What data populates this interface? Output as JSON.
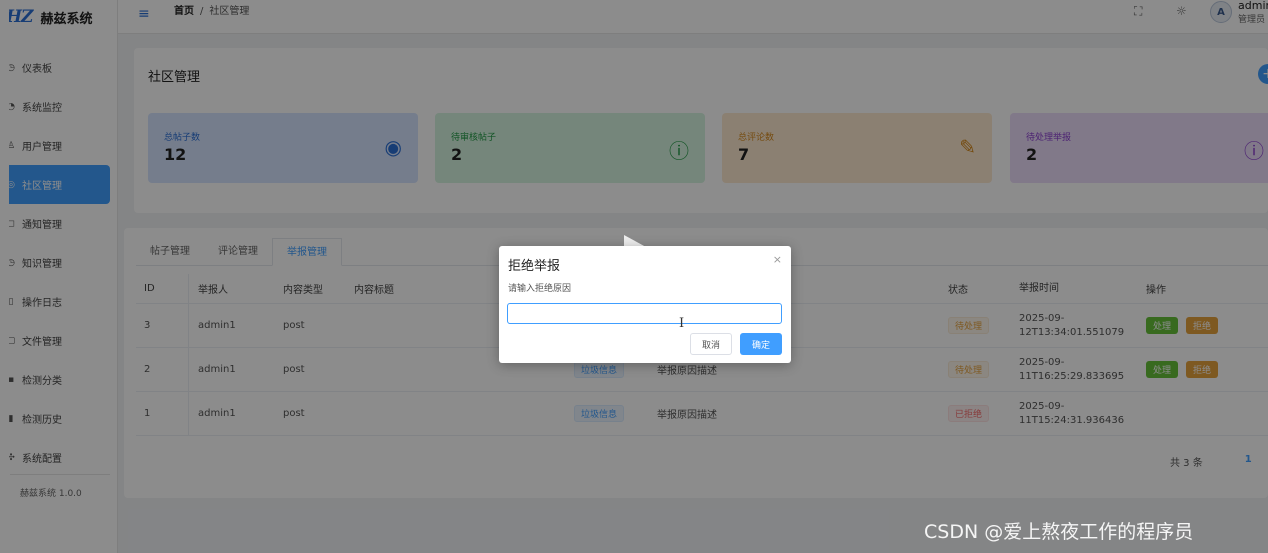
{
  "app": {
    "logo_mark": "HZ",
    "name": "赫兹系统",
    "version": "赫兹系统 1.0.0"
  },
  "sidebar": {
    "items": [
      {
        "label": "仪表板",
        "icon": "dashboard-icon",
        "glyph": "◷"
      },
      {
        "label": "系统监控",
        "icon": "monitor-icon",
        "glyph": "◔"
      },
      {
        "label": "用户管理",
        "icon": "user-icon",
        "glyph": "♙"
      },
      {
        "label": "社区管理",
        "icon": "community-icon",
        "glyph": "◎",
        "active": true
      },
      {
        "label": "通知管理",
        "icon": "bell-icon",
        "glyph": "◻"
      },
      {
        "label": "知识管理",
        "icon": "book-icon",
        "glyph": "◷"
      },
      {
        "label": "操作日志",
        "icon": "log-icon",
        "glyph": "▯"
      },
      {
        "label": "文件管理",
        "icon": "file-icon",
        "glyph": "▢"
      },
      {
        "label": "检测分类",
        "icon": "category-icon",
        "glyph": "▪"
      },
      {
        "label": "检测历史",
        "icon": "history-icon",
        "glyph": "▮"
      },
      {
        "label": "系统配置",
        "icon": "settings-icon",
        "glyph": "✣"
      }
    ]
  },
  "header": {
    "breadcrumb_home": "首页",
    "breadcrumb_sep": "/",
    "breadcrumb_current": "社区管理",
    "user_initial": "A",
    "user_name": "admin",
    "user_role": "管理员"
  },
  "page": {
    "title": "社区管理",
    "add_glyph": "+"
  },
  "stats": [
    {
      "label": "总帖子数",
      "value": "12",
      "icon": "eye-icon",
      "glyph": "◉"
    },
    {
      "label": "待审核帖子",
      "value": "2",
      "icon": "alert-circle-icon",
      "glyph": "ⓘ"
    },
    {
      "label": "总评论数",
      "value": "7",
      "icon": "edit-icon",
      "glyph": "✎"
    },
    {
      "label": "待处理举报",
      "value": "2",
      "icon": "warning-circle-icon",
      "glyph": "ⓘ"
    }
  ],
  "tabs": [
    {
      "label": "帖子管理",
      "active": false
    },
    {
      "label": "评论管理",
      "active": false
    },
    {
      "label": "举报管理",
      "active": true
    }
  ],
  "table": {
    "headers": {
      "id": "ID",
      "reporter": "举报人",
      "type": "内容类型",
      "title": "内容标题",
      "status": "状态",
      "time": "举报时间",
      "ops": "操作"
    },
    "rows": [
      {
        "id": "3",
        "reporter": "admin1",
        "type": "post",
        "reason": "",
        "desc": "",
        "status": "待处理",
        "status_kind": "pending",
        "time_1": "2025-09-",
        "time_2": "12T13:34:01.551079",
        "ops": [
          "处理",
          "拒绝"
        ]
      },
      {
        "id": "2",
        "reporter": "admin1",
        "type": "post",
        "reason": "垃圾信息",
        "desc": "举报原因描述",
        "status": "待处理",
        "status_kind": "pending",
        "time_1": "2025-09-",
        "time_2": "11T16:25:29.833695",
        "ops": [
          "处理",
          "拒绝"
        ]
      },
      {
        "id": "1",
        "reporter": "admin1",
        "type": "post",
        "reason": "垃圾信息",
        "desc": "举报原因描述",
        "status": "已拒绝",
        "status_kind": "rejected",
        "time_1": "2025-09-",
        "time_2": "11T15:24:31.936436",
        "ops": []
      }
    ]
  },
  "pagination": {
    "total": "共 3 条",
    "current": "1"
  },
  "dialog": {
    "title": "拒绝举报",
    "close_glyph": "×",
    "label": "请输入拒绝原因",
    "input_value": "",
    "input_placeholder": "",
    "cancel": "取消",
    "confirm": "确定"
  },
  "watermark": "CSDN @爱上熬夜工作的程序员"
}
